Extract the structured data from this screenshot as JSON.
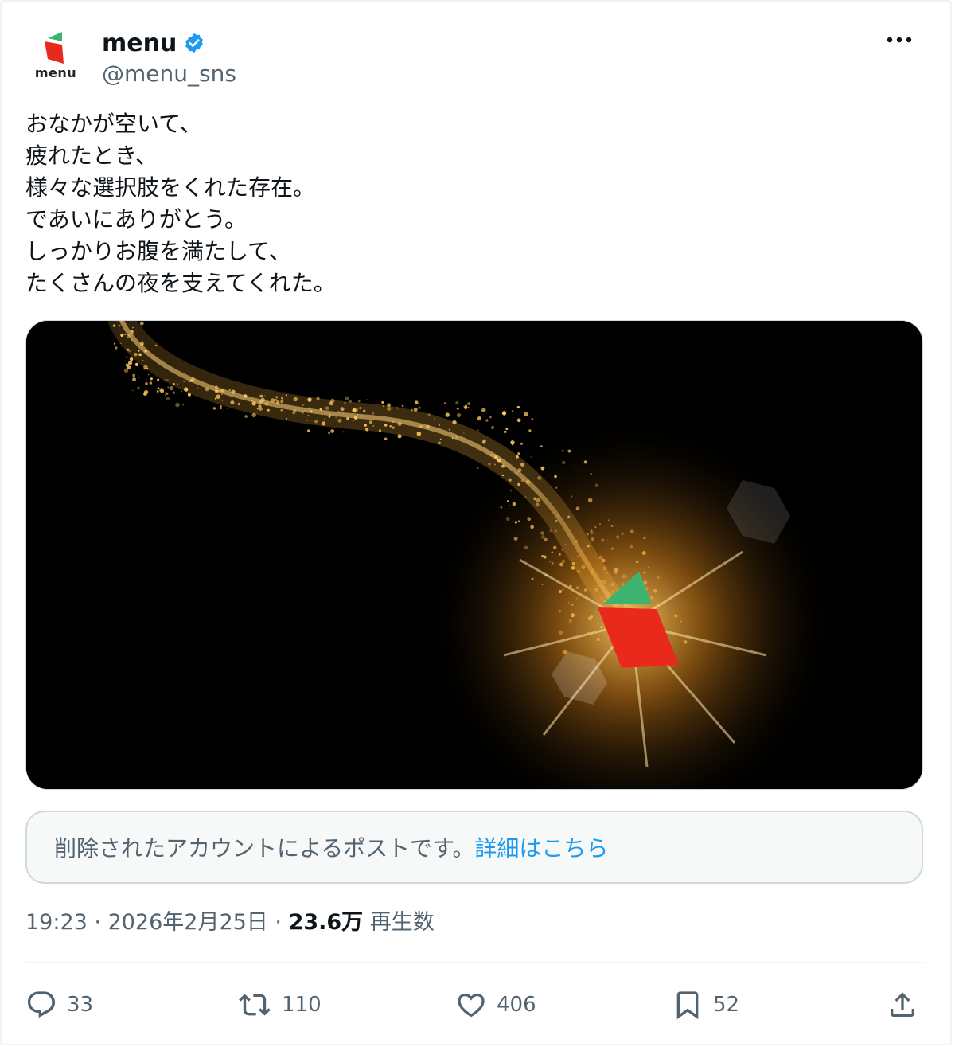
{
  "account": {
    "display_name": "menu",
    "handle": "@menu_sns",
    "logo_text": "menu",
    "verified_icon": "verified-badge-icon",
    "colors": {
      "logo_red": "#e8291c",
      "logo_green": "#3cb371",
      "verified": "#1d9bf0"
    }
  },
  "tweet": {
    "lines": [
      "おなかが空いて、",
      "疲れたとき、",
      "様々な選択肢をくれた存在。",
      "であいにありがとう。",
      "しっかりお腹を満たして、",
      "たくさんの夜を支えてくれた。"
    ]
  },
  "notice": {
    "text": "削除されたアカウントによるポストです。",
    "link": "詳細はこちら"
  },
  "meta": {
    "time": "19:23",
    "sep1": " · ",
    "date": "2026年2月25日",
    "sep2": " · ",
    "views": "23.6万",
    "views_label": " 再生数"
  },
  "actions": {
    "reply": {
      "icon": "reply-icon",
      "count": "33"
    },
    "repost": {
      "icon": "repost-icon",
      "count": "110"
    },
    "like": {
      "icon": "like-icon",
      "count": "406"
    },
    "bookmark": {
      "icon": "bookmark-icon",
      "count": "52"
    },
    "share": {
      "icon": "share-icon"
    }
  },
  "colors": {
    "link": "#1d9bf0",
    "muted": "#536471",
    "text": "#0f1419",
    "gold": "#f4b13d"
  }
}
